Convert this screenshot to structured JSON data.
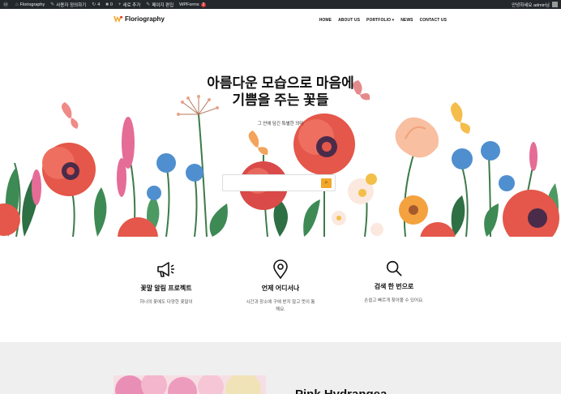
{
  "adminbar": {
    "items": [
      {
        "icon": "wordpress-icon",
        "glyph": "Ⓦ",
        "label": ""
      },
      {
        "icon": "home-icon",
        "glyph": "⌂",
        "label": "Floriography"
      },
      {
        "icon": "customize-icon",
        "glyph": "✎",
        "label": "사용자 정의하기"
      },
      {
        "icon": "updates-icon",
        "glyph": "↻",
        "label": "4"
      },
      {
        "icon": "comments-icon",
        "glyph": "■",
        "label": "0"
      },
      {
        "icon": "new-icon",
        "glyph": "+",
        "label": "새로 추가"
      },
      {
        "icon": "edit-icon",
        "glyph": "✎",
        "label": "페이지 편집"
      },
      {
        "icon": "",
        "glyph": "",
        "label": "WPForms",
        "badge": "2"
      }
    ],
    "greeting": "안녕하세요 admin님"
  },
  "header": {
    "logo_text": "Floriography",
    "nav": [
      "HOME",
      "ABOUT US",
      "PORTFOLIO ▾",
      "NEWS",
      "CONTACT US"
    ]
  },
  "hero": {
    "title_line1": "아름다운 모습으로 마음에",
    "title_line2": "기쁨을 주는 꽃들",
    "subtitle": "그 안에 담긴 특별한 의미",
    "search_placeholder": "",
    "search_button_glyph": "⌕"
  },
  "features": [
    {
      "icon": "megaphone-icon",
      "title": "꽃말 알림 프로젝트",
      "desc": "하나의 꽃에도 다양한 꽃말이"
    },
    {
      "icon": "location-pin-icon",
      "title": "언제 어디서나",
      "desc": "시간과 장소에 구애 받지 않고 뜻이 통해요."
    },
    {
      "icon": "search-icon",
      "title": "검색 한 번으로",
      "desc": "손쉽고 빠르게 찾아볼 수 있어요."
    }
  ],
  "product": {
    "title": "Pink Hydrangea"
  },
  "colors": {
    "adminbar": "#23282d",
    "accent": "#f2a72a",
    "band": "#efefef"
  }
}
